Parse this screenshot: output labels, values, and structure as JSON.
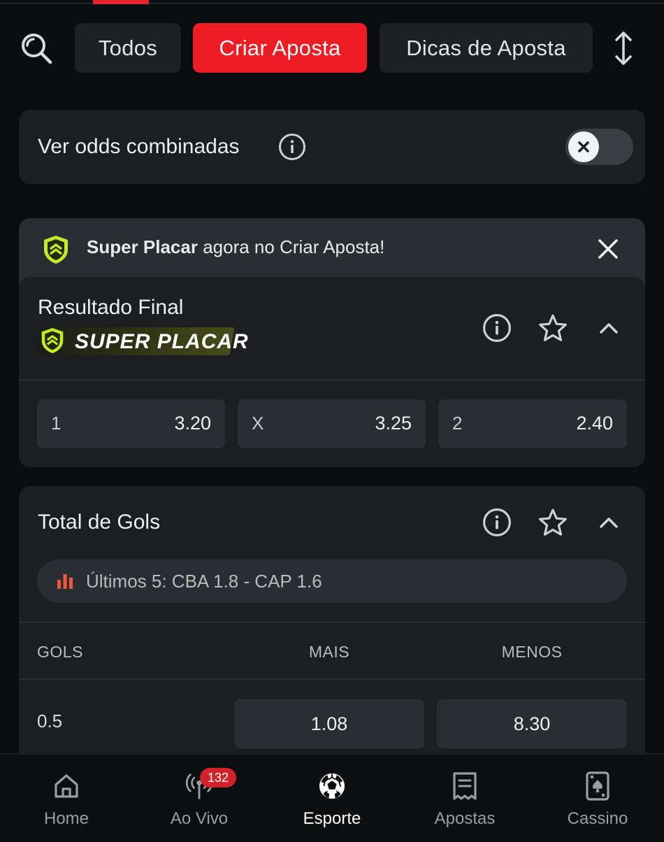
{
  "tabs": {
    "all": "Todos",
    "create_bet": "Criar Aposta",
    "bet_tips": "Dicas de Aposta"
  },
  "combined_odds": {
    "label": "Ver odds combinadas",
    "toggle_state": "off"
  },
  "banner": {
    "bold": "Super Placar",
    "rest": " agora no Criar Aposta!"
  },
  "market_final_result": {
    "title": "Resultado Final",
    "badge": "SUPER PLACAR",
    "odds": [
      {
        "label": "1",
        "value": "3.20"
      },
      {
        "label": "X",
        "value": "3.25"
      },
      {
        "label": "2",
        "value": "2.40"
      }
    ]
  },
  "market_total_goals": {
    "title": "Total de Gols",
    "stats": "Últimos 5: CBA 1.8 - CAP 1.6",
    "columns": {
      "goals": "GOLS",
      "over": "MAIS",
      "under": "MENOS"
    },
    "rows": [
      {
        "line": "0.5",
        "over": "1.08",
        "under": "8.30"
      }
    ]
  },
  "bottom_nav": {
    "items": [
      {
        "label": "Home",
        "icon": "home-icon"
      },
      {
        "label": "Ao Vivo",
        "icon": "live-broadcast-icon",
        "badge": "132"
      },
      {
        "label": "Esporte",
        "icon": "soccer-ball-icon",
        "active": true
      },
      {
        "label": "Apostas",
        "icon": "bet-slip-icon"
      },
      {
        "label": "Cassino",
        "icon": "playing-card-icon"
      }
    ]
  },
  "colors": {
    "accent": "#ee1c23",
    "background": "#0b0c0e",
    "card": "#1c1e22",
    "super_placar_green": "#c6e82a"
  }
}
